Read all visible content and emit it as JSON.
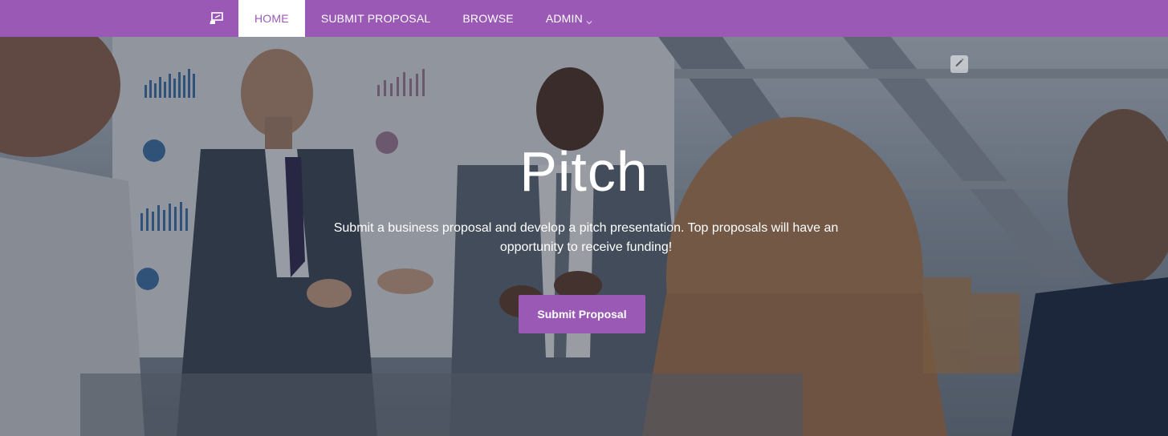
{
  "nav": {
    "logo_icon": "presentation-board-icon",
    "items": [
      {
        "label": "HOME",
        "active": true
      },
      {
        "label": "SUBMIT PROPOSAL",
        "active": false
      },
      {
        "label": "BROWSE",
        "active": false
      },
      {
        "label": "ADMIN",
        "active": false,
        "has_dropdown": true
      }
    ]
  },
  "hero": {
    "title": "Pitch",
    "description": "Submit a business proposal and develop a pitch presentation. Top proposals will have an opportunity to receive funding!",
    "cta_label": "Submit Proposal",
    "edit_icon": "pencil-icon"
  },
  "colors": {
    "brand": "#9b59b6",
    "nav_text": "#ffffff",
    "active_tab_bg": "#ffffff"
  }
}
